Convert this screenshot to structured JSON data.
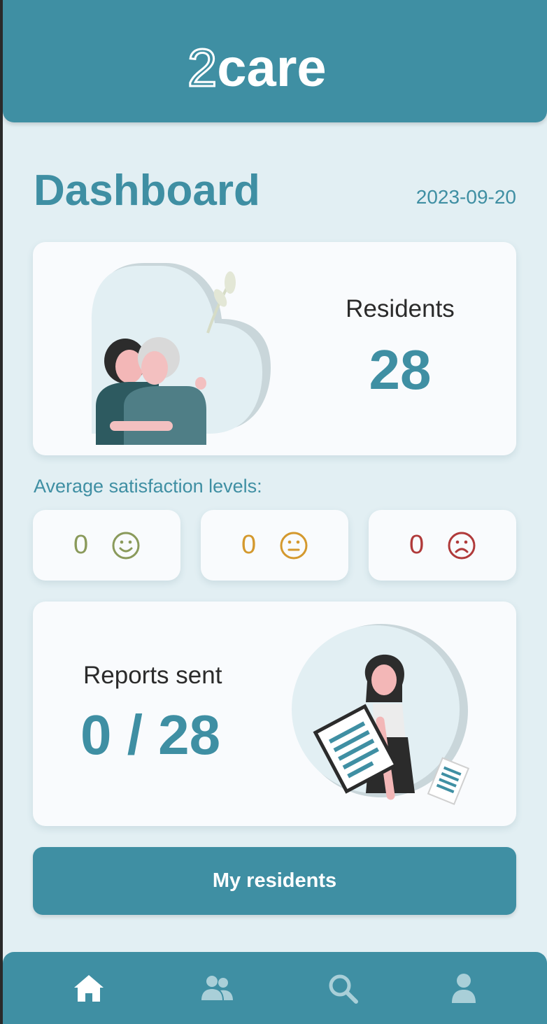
{
  "app": {
    "logo_num": "2",
    "logo_word": "care"
  },
  "dashboard": {
    "title": "Dashboard",
    "date": "2023-09-20"
  },
  "residents": {
    "label": "Residents",
    "count": "28"
  },
  "satisfaction": {
    "title": "Average satisfaction levels:",
    "levels": [
      {
        "value": "0",
        "icon": "smile-face-icon",
        "color": "#8a9a5b"
      },
      {
        "value": "0",
        "icon": "neutral-face-icon",
        "color": "#d4992e"
      },
      {
        "value": "0",
        "icon": "frown-face-icon",
        "color": "#b03a3a"
      }
    ]
  },
  "reports": {
    "label": "Reports sent",
    "count": "0 / 28"
  },
  "actions": {
    "my_residents": "My residents"
  },
  "nav": {
    "items": [
      {
        "icon": "home-icon",
        "active": true
      },
      {
        "icon": "users-icon",
        "active": false
      },
      {
        "icon": "search-icon",
        "active": false
      },
      {
        "icon": "user-icon",
        "active": false
      }
    ]
  },
  "colors": {
    "brand": "#3f8fa3",
    "background": "#e2eff3",
    "card": "#f9fbfd"
  }
}
